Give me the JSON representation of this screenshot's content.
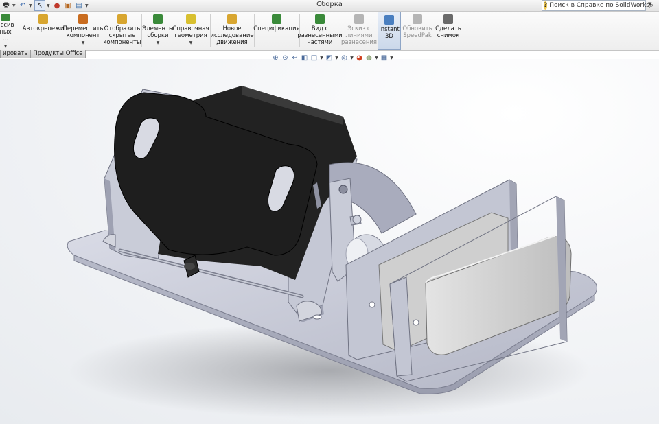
{
  "window": {
    "title": "Сборка"
  },
  "quick_access": {
    "items": [
      "print-icon",
      "undo-icon",
      "select-icon",
      "traffic-light-icon",
      "file-properties-icon",
      "options-icon"
    ]
  },
  "help_search": {
    "placeholder": "Поиск в Справке по SolidWorks"
  },
  "ribbon": {
    "buttons": [
      {
        "id": "massiv",
        "label": "ассив\nных ...",
        "icon": "pattern-icon",
        "color": "#3a8a3a",
        "has_dropdown": true
      },
      {
        "id": "autofasteners",
        "label": "Автокрепежи",
        "icon": "fastener-icon",
        "color": "#d8a630"
      },
      {
        "id": "move",
        "label": "Переместить\nкомпонент",
        "icon": "move-component-icon",
        "color": "#c96c1f",
        "has_dropdown": true
      },
      {
        "id": "show-hidden",
        "label": "Отобразить\nскрытые\nкомпоненты",
        "icon": "show-hidden-icon",
        "color": "#d8a630"
      },
      {
        "id": "assembly-features",
        "label": "Элементы\nсборки",
        "icon": "assembly-features-icon",
        "color": "#3a8a3a",
        "has_dropdown": true
      },
      {
        "id": "ref-geometry",
        "label": "Справочная\nгеометрия",
        "icon": "reference-geometry-icon",
        "color": "#d8c030",
        "has_dropdown": true
      },
      {
        "id": "motion-study",
        "label": "Новое\nисследование\nдвижения",
        "icon": "motion-study-icon",
        "color": "#d8a630"
      },
      {
        "id": "bom",
        "label": "Спецификация",
        "icon": "bom-icon",
        "color": "#3a8a3a"
      },
      {
        "id": "exploded-view",
        "label": "Вид с\nразнесенными\nчастями",
        "icon": "exploded-view-icon",
        "color": "#3a8a3a"
      },
      {
        "id": "explode-sketch",
        "label": "Эскиз с\nлиниями\nразнесения",
        "icon": "explode-line-sketch-icon",
        "color": "#9a9a9a",
        "disabled": true
      },
      {
        "id": "instant3d",
        "label": "Instant\n3D",
        "icon": "instant3d-icon",
        "color": "#4a7fc0",
        "active": true
      },
      {
        "id": "speedpak",
        "label": "Обновить\nSpeedPak",
        "icon": "speedpak-icon",
        "color": "#9a9a9a",
        "disabled": true
      },
      {
        "id": "snapshot",
        "label": "Сделать\nснимок",
        "icon": "snapshot-icon",
        "color": "#6a6a6a"
      }
    ]
  },
  "tabs": [
    {
      "label": "ировать"
    },
    {
      "label": "Продукты Office"
    }
  ],
  "view_toolbar": {
    "items": [
      "zoom-to-fit-icon",
      "zoom-area-icon",
      "previous-view-icon",
      "section-view-icon",
      "view-orientation-icon",
      "display-style-icon",
      "hide-show-items-icon",
      "edit-appearance-icon",
      "apply-scene-icon",
      "view-settings-icon"
    ]
  },
  "viewport": {
    "model": "3D assembly: base plate with motor bracket, black stepper motor, pivot arm and clamp jaws holding a grey block",
    "colors": {
      "plate": "#c3c6d3",
      "plate_edge": "#8d90a0",
      "motor": "#2a2a2a",
      "block": "#cdcdcd",
      "background": "#f2f4f7"
    }
  }
}
